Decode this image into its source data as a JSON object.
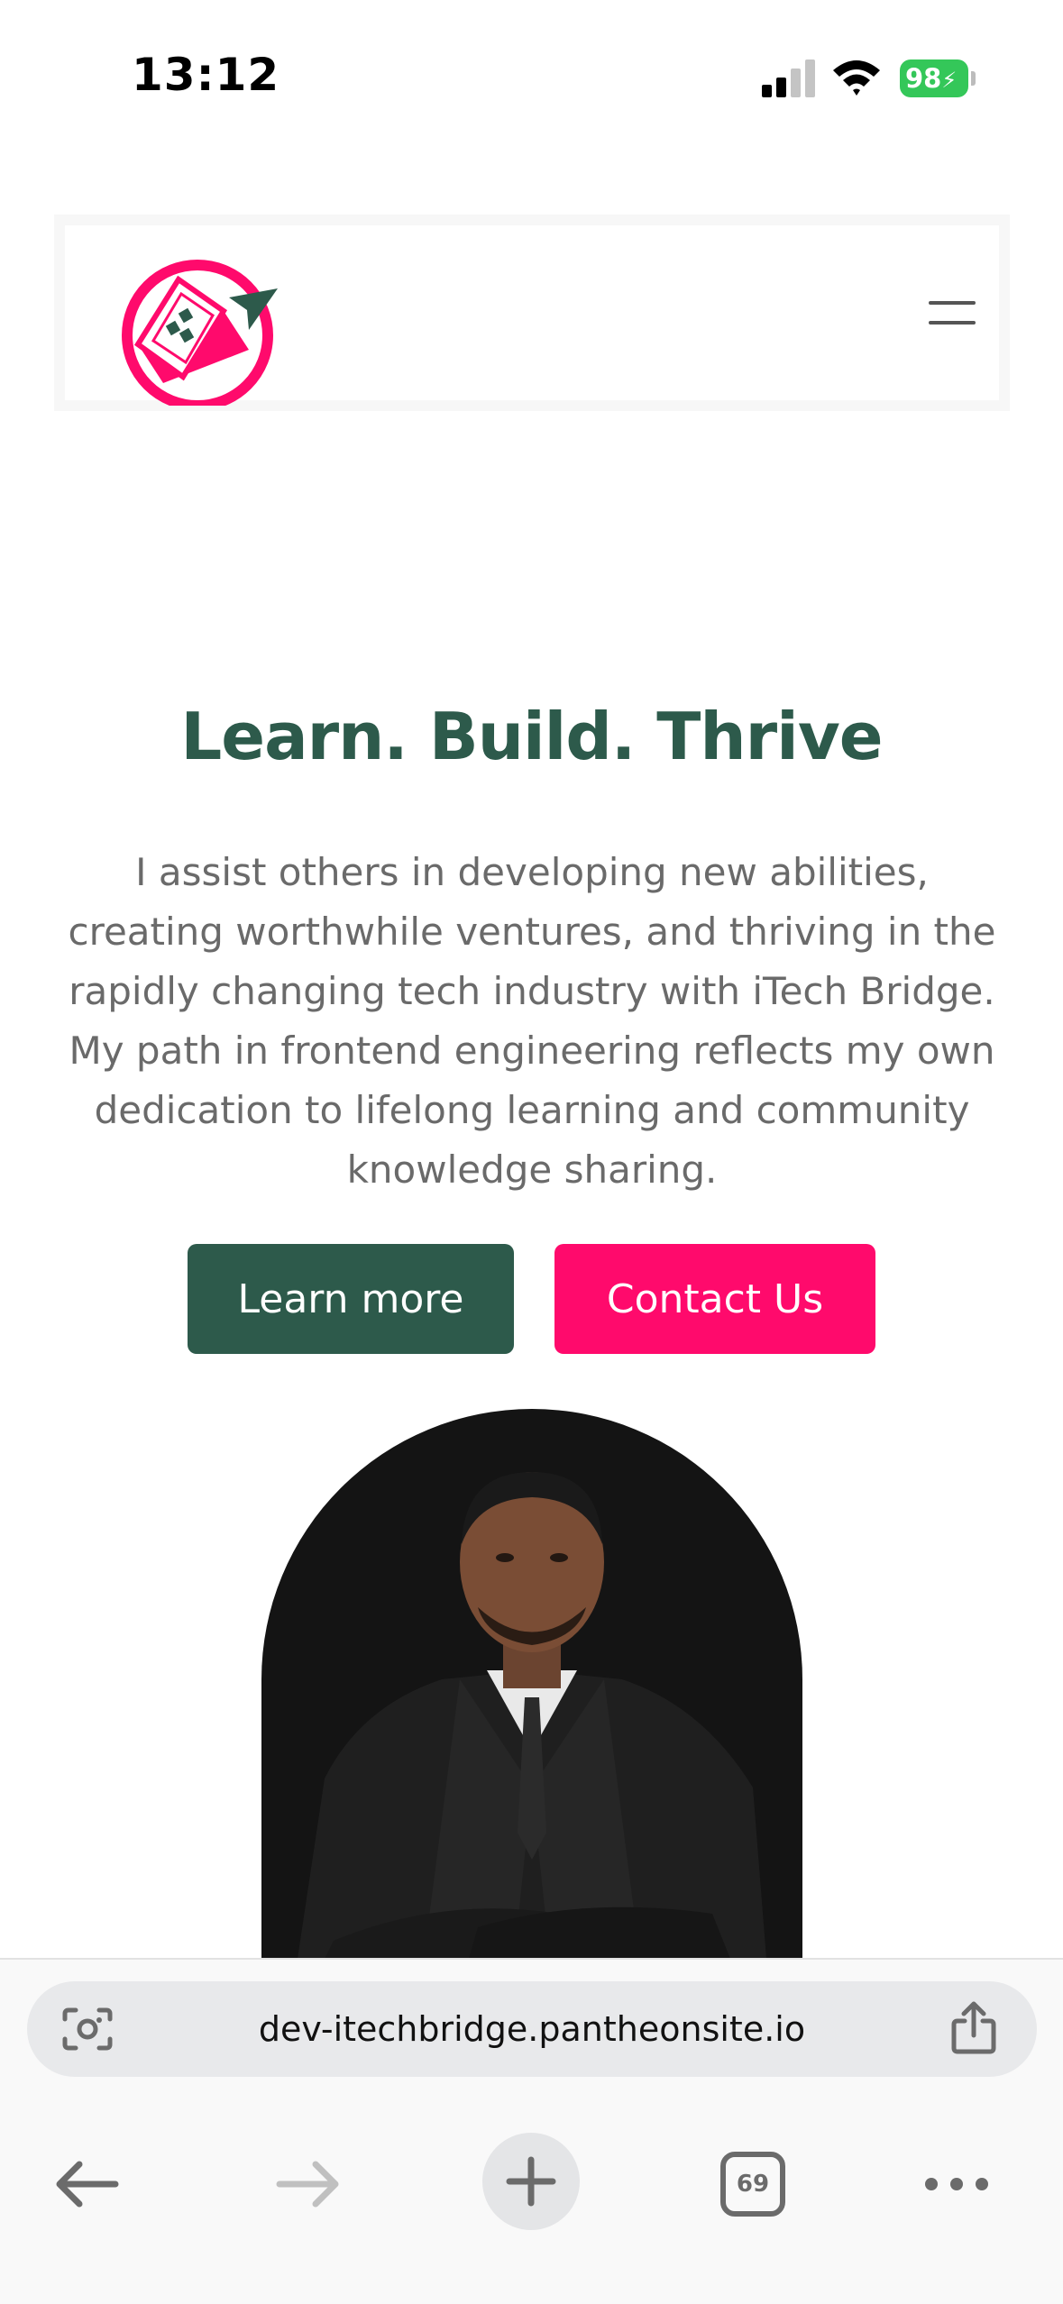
{
  "status_bar": {
    "time": "13:12",
    "battery": "98",
    "icons": [
      "cellular-signal-icon",
      "wifi-icon",
      "battery-charging-icon"
    ]
  },
  "header": {
    "logo_name": "itechbridge-logo",
    "menu_icon": "hamburger-menu-icon"
  },
  "hero": {
    "title": "Learn. Build. Thrive",
    "description": "I assist others in developing new abilities, creating worthwhile ventures, and thriving in the rapidly changing tech industry with iTech Bridge. My path in frontend engineering reflects my own dedication to lifelong learning and community knowledge sharing.",
    "primary_button": "Learn more",
    "secondary_button": "Contact Us"
  },
  "browser": {
    "url": "dev-itechbridge.pantheonsite.io",
    "tab_count": "69",
    "icons": [
      "visual-search-icon",
      "share-icon",
      "back-arrow-icon",
      "forward-arrow-icon",
      "plus-icon",
      "tabs-icon",
      "more-icon"
    ]
  },
  "colors": {
    "brand_green": "#2d5a4b",
    "brand_pink": "#ff0a6c",
    "body_text": "#6a6a6a"
  }
}
